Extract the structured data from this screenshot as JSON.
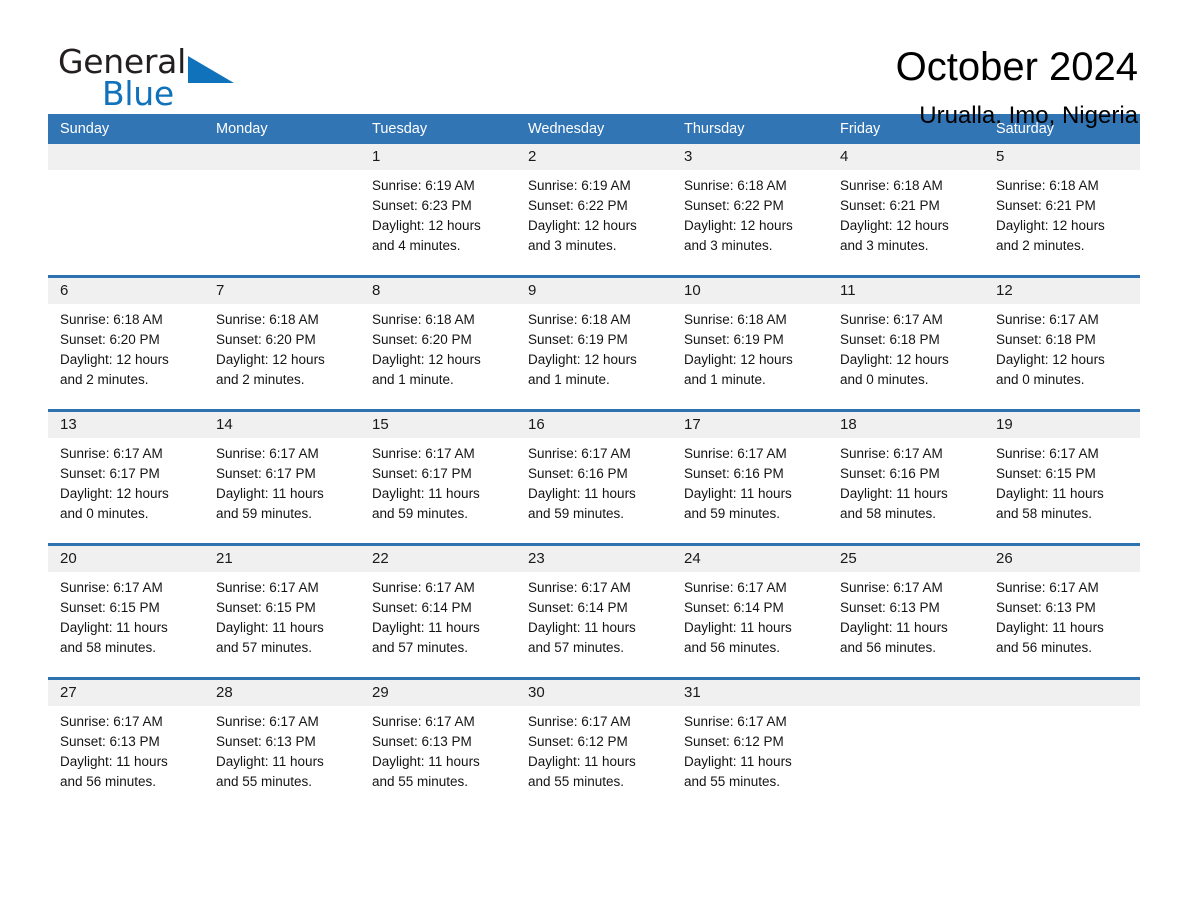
{
  "brand": {
    "name_part1": "General",
    "name_part2": "Blue",
    "triangle_color": "#1072bb"
  },
  "header": {
    "month_title": "October 2024",
    "location": "Urualla, Imo, Nigeria",
    "header_bg_color": "#3275b5",
    "row_rule_color": "#2e72b0",
    "daynum_bg_color": "#f0f0f0"
  },
  "labels": {
    "sunrise_prefix": "Sunrise:",
    "sunset_prefix": "Sunset:",
    "daylight_prefix": "Daylight:"
  },
  "weekdays": [
    "Sunday",
    "Monday",
    "Tuesday",
    "Wednesday",
    "Thursday",
    "Friday",
    "Saturday"
  ],
  "weeks": [
    [
      {
        "day": "",
        "sunrise": "",
        "sunset": "",
        "daylight_1": "",
        "daylight_2": ""
      },
      {
        "day": "",
        "sunrise": "",
        "sunset": "",
        "daylight_1": "",
        "daylight_2": ""
      },
      {
        "day": "1",
        "sunrise": "Sunrise: 6:19 AM",
        "sunset": "Sunset: 6:23 PM",
        "daylight_1": "Daylight: 12 hours",
        "daylight_2": "and 4 minutes."
      },
      {
        "day": "2",
        "sunrise": "Sunrise: 6:19 AM",
        "sunset": "Sunset: 6:22 PM",
        "daylight_1": "Daylight: 12 hours",
        "daylight_2": "and 3 minutes."
      },
      {
        "day": "3",
        "sunrise": "Sunrise: 6:18 AM",
        "sunset": "Sunset: 6:22 PM",
        "daylight_1": "Daylight: 12 hours",
        "daylight_2": "and 3 minutes."
      },
      {
        "day": "4",
        "sunrise": "Sunrise: 6:18 AM",
        "sunset": "Sunset: 6:21 PM",
        "daylight_1": "Daylight: 12 hours",
        "daylight_2": "and 3 minutes."
      },
      {
        "day": "5",
        "sunrise": "Sunrise: 6:18 AM",
        "sunset": "Sunset: 6:21 PM",
        "daylight_1": "Daylight: 12 hours",
        "daylight_2": "and 2 minutes."
      }
    ],
    [
      {
        "day": "6",
        "sunrise": "Sunrise: 6:18 AM",
        "sunset": "Sunset: 6:20 PM",
        "daylight_1": "Daylight: 12 hours",
        "daylight_2": "and 2 minutes."
      },
      {
        "day": "7",
        "sunrise": "Sunrise: 6:18 AM",
        "sunset": "Sunset: 6:20 PM",
        "daylight_1": "Daylight: 12 hours",
        "daylight_2": "and 2 minutes."
      },
      {
        "day": "8",
        "sunrise": "Sunrise: 6:18 AM",
        "sunset": "Sunset: 6:20 PM",
        "daylight_1": "Daylight: 12 hours",
        "daylight_2": "and 1 minute."
      },
      {
        "day": "9",
        "sunrise": "Sunrise: 6:18 AM",
        "sunset": "Sunset: 6:19 PM",
        "daylight_1": "Daylight: 12 hours",
        "daylight_2": "and 1 minute."
      },
      {
        "day": "10",
        "sunrise": "Sunrise: 6:18 AM",
        "sunset": "Sunset: 6:19 PM",
        "daylight_1": "Daylight: 12 hours",
        "daylight_2": "and 1 minute."
      },
      {
        "day": "11",
        "sunrise": "Sunrise: 6:17 AM",
        "sunset": "Sunset: 6:18 PM",
        "daylight_1": "Daylight: 12 hours",
        "daylight_2": "and 0 minutes."
      },
      {
        "day": "12",
        "sunrise": "Sunrise: 6:17 AM",
        "sunset": "Sunset: 6:18 PM",
        "daylight_1": "Daylight: 12 hours",
        "daylight_2": "and 0 minutes."
      }
    ],
    [
      {
        "day": "13",
        "sunrise": "Sunrise: 6:17 AM",
        "sunset": "Sunset: 6:17 PM",
        "daylight_1": "Daylight: 12 hours",
        "daylight_2": "and 0 minutes."
      },
      {
        "day": "14",
        "sunrise": "Sunrise: 6:17 AM",
        "sunset": "Sunset: 6:17 PM",
        "daylight_1": "Daylight: 11 hours",
        "daylight_2": "and 59 minutes."
      },
      {
        "day": "15",
        "sunrise": "Sunrise: 6:17 AM",
        "sunset": "Sunset: 6:17 PM",
        "daylight_1": "Daylight: 11 hours",
        "daylight_2": "and 59 minutes."
      },
      {
        "day": "16",
        "sunrise": "Sunrise: 6:17 AM",
        "sunset": "Sunset: 6:16 PM",
        "daylight_1": "Daylight: 11 hours",
        "daylight_2": "and 59 minutes."
      },
      {
        "day": "17",
        "sunrise": "Sunrise: 6:17 AM",
        "sunset": "Sunset: 6:16 PM",
        "daylight_1": "Daylight: 11 hours",
        "daylight_2": "and 59 minutes."
      },
      {
        "day": "18",
        "sunrise": "Sunrise: 6:17 AM",
        "sunset": "Sunset: 6:16 PM",
        "daylight_1": "Daylight: 11 hours",
        "daylight_2": "and 58 minutes."
      },
      {
        "day": "19",
        "sunrise": "Sunrise: 6:17 AM",
        "sunset": "Sunset: 6:15 PM",
        "daylight_1": "Daylight: 11 hours",
        "daylight_2": "and 58 minutes."
      }
    ],
    [
      {
        "day": "20",
        "sunrise": "Sunrise: 6:17 AM",
        "sunset": "Sunset: 6:15 PM",
        "daylight_1": "Daylight: 11 hours",
        "daylight_2": "and 58 minutes."
      },
      {
        "day": "21",
        "sunrise": "Sunrise: 6:17 AM",
        "sunset": "Sunset: 6:15 PM",
        "daylight_1": "Daylight: 11 hours",
        "daylight_2": "and 57 minutes."
      },
      {
        "day": "22",
        "sunrise": "Sunrise: 6:17 AM",
        "sunset": "Sunset: 6:14 PM",
        "daylight_1": "Daylight: 11 hours",
        "daylight_2": "and 57 minutes."
      },
      {
        "day": "23",
        "sunrise": "Sunrise: 6:17 AM",
        "sunset": "Sunset: 6:14 PM",
        "daylight_1": "Daylight: 11 hours",
        "daylight_2": "and 57 minutes."
      },
      {
        "day": "24",
        "sunrise": "Sunrise: 6:17 AM",
        "sunset": "Sunset: 6:14 PM",
        "daylight_1": "Daylight: 11 hours",
        "daylight_2": "and 56 minutes."
      },
      {
        "day": "25",
        "sunrise": "Sunrise: 6:17 AM",
        "sunset": "Sunset: 6:13 PM",
        "daylight_1": "Daylight: 11 hours",
        "daylight_2": "and 56 minutes."
      },
      {
        "day": "26",
        "sunrise": "Sunrise: 6:17 AM",
        "sunset": "Sunset: 6:13 PM",
        "daylight_1": "Daylight: 11 hours",
        "daylight_2": "and 56 minutes."
      }
    ],
    [
      {
        "day": "27",
        "sunrise": "Sunrise: 6:17 AM",
        "sunset": "Sunset: 6:13 PM",
        "daylight_1": "Daylight: 11 hours",
        "daylight_2": "and 56 minutes."
      },
      {
        "day": "28",
        "sunrise": "Sunrise: 6:17 AM",
        "sunset": "Sunset: 6:13 PM",
        "daylight_1": "Daylight: 11 hours",
        "daylight_2": "and 55 minutes."
      },
      {
        "day": "29",
        "sunrise": "Sunrise: 6:17 AM",
        "sunset": "Sunset: 6:13 PM",
        "daylight_1": "Daylight: 11 hours",
        "daylight_2": "and 55 minutes."
      },
      {
        "day": "30",
        "sunrise": "Sunrise: 6:17 AM",
        "sunset": "Sunset: 6:12 PM",
        "daylight_1": "Daylight: 11 hours",
        "daylight_2": "and 55 minutes."
      },
      {
        "day": "31",
        "sunrise": "Sunrise: 6:17 AM",
        "sunset": "Sunset: 6:12 PM",
        "daylight_1": "Daylight: 11 hours",
        "daylight_2": "and 55 minutes."
      },
      {
        "day": "",
        "sunrise": "",
        "sunset": "",
        "daylight_1": "",
        "daylight_2": ""
      },
      {
        "day": "",
        "sunrise": "",
        "sunset": "",
        "daylight_1": "",
        "daylight_2": ""
      }
    ]
  ]
}
